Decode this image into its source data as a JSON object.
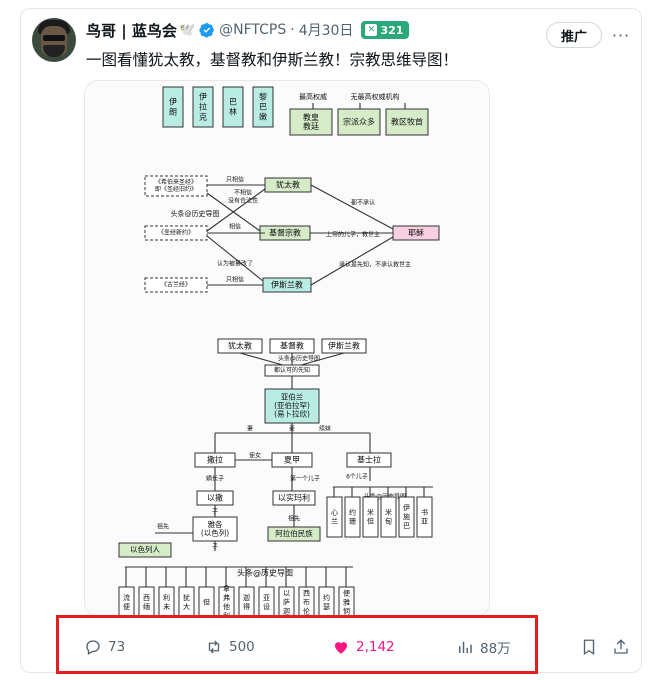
{
  "author": {
    "display_name": "鸟哥 | 蓝鸟会",
    "bird_emoji": "🕊️",
    "handle": "@NFTCPS",
    "separator": "·",
    "date": "4月30日",
    "badge_count": "321"
  },
  "header_actions": {
    "promote_label": "推广",
    "more_label": "···"
  },
  "tweet": {
    "text": "一图看懂犹太教，基督教和伊斯兰教！宗教思维导图！"
  },
  "media": {
    "top_columns": [
      "伊朗",
      "伊拉克",
      "巴林",
      "黎巴嫩"
    ],
    "authority_labels": [
      "最高权威",
      "无最高权威机构"
    ],
    "authority_boxes": [
      "教皇教廷",
      "宗派众多",
      "教区牧首"
    ],
    "scripture_boxes": [
      "《希伯来圣经》即《圣经旧约》",
      "《圣经新约》",
      "《古兰经》"
    ],
    "religions": [
      "犹太教",
      "基督宗教",
      "伊斯兰教"
    ],
    "jesus_box": "耶稣",
    "relation_labels": [
      "只相信",
      "不相信",
      "没有合法性",
      "相信",
      "相信",
      "认为被篡改了",
      "只相信",
      "都不承认",
      "上帝的儿子，救世主",
      "承认是先知，不承认救世主"
    ],
    "watermark": "头条@历史导图",
    "second_tier": [
      "犹太教",
      "基督教",
      "伊斯兰教"
    ],
    "common_prophet": "都认可的先知",
    "abraham": "亚伯兰\n(亚伯拉罕)\n(易卜拉欣)",
    "edge_labels": [
      "妻",
      "妾",
      "续妹"
    ],
    "children": [
      "撒拉",
      "夏甲",
      "基士拉"
    ],
    "wife_label": "使女",
    "kids_labels": [
      "嫡长子",
      "第一个儿子",
      "6个儿子"
    ],
    "sons": [
      "以撒",
      "以实玛利"
    ],
    "ancestor_label": "祖先",
    "jacob": "雅各\n(以色列)",
    "israelites": "以色列人",
    "arabs": "阿拉伯民族",
    "keturah_sons": [
      "心兰",
      "约珊",
      "米但",
      "米甸",
      "伊施巴",
      "书亚"
    ],
    "son_marker": "子",
    "tribes": [
      "流便",
      "西缅",
      "利未",
      "犹大",
      "但",
      "拿弗他利",
      "迦得",
      "亚设",
      "以萨迦",
      "西布伦",
      "约瑟",
      "便雅悯"
    ]
  },
  "engagement": {
    "replies": "73",
    "reposts": "500",
    "likes": "2,142",
    "views": "88万"
  },
  "colors": {
    "accent_like": "#f91880",
    "muted_text": "#536471",
    "badge_green": "#2aa87a",
    "verified_blue": "#1d9bf0",
    "highlight_red": "#e02020",
    "teal_box": "#b9ece3",
    "green_box": "#d6ecc8",
    "pink_box": "#f8cfe0"
  },
  "icons": [
    "reply-icon",
    "repost-icon",
    "heart-icon",
    "views-icon",
    "bookmark-icon",
    "share-icon",
    "verified-icon"
  ]
}
